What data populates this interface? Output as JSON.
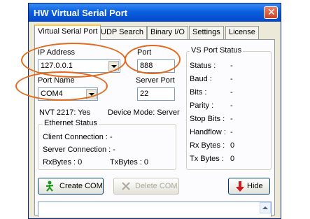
{
  "window": {
    "title": "HW Virtual Serial Port",
    "close_glyph": "✕"
  },
  "tabs": [
    "Virtual Serial Port",
    "UDP Search",
    "Binary I/O",
    "Settings",
    "License"
  ],
  "active_tab": 0,
  "form": {
    "ip_label": "IP Address",
    "ip_value": "127.0.0.1",
    "port_label": "Port",
    "port_value": "888",
    "portname_label": "Port Name",
    "portname_value": "COM4",
    "serverport_label": "Server Port",
    "serverport_value": "22",
    "nvt_text": "NVT 2217:  Yes",
    "device_mode_text": "Device Mode:  Server"
  },
  "ethernet": {
    "title": "Ethernet Status",
    "client_connection": "Client Connection  :  -",
    "server_connection": "Server Connection :  -",
    "rx_bytes": "RxBytes :  0",
    "tx_bytes": "TxBytes :  0"
  },
  "vs_status": {
    "title": "VS Port Status",
    "rows": [
      {
        "label": "Status :",
        "value": "-"
      },
      {
        "label": "Baud :",
        "value": "-"
      },
      {
        "label": "Bits :",
        "value": "-"
      },
      {
        "label": "Parity :",
        "value": "-"
      },
      {
        "label": "Stop Bits :",
        "value": "-"
      },
      {
        "label": "Handflow :",
        "value": "-"
      },
      {
        "label": "Rx Bytes :",
        "value": "0"
      },
      {
        "label": "Tx Bytes :",
        "value": "0"
      }
    ]
  },
  "buttons": {
    "create_com": "Create COM",
    "delete_com": "Delete COM",
    "hide": "Hide"
  },
  "colors": {
    "annotation": "#e06a1d",
    "title_bar": "#0a5fe0",
    "tab_highlight": "#ffc83c"
  },
  "icons": {
    "create": "green-man-icon",
    "delete": "grey-x-icon",
    "hide": "red-down-arrow-icon"
  }
}
